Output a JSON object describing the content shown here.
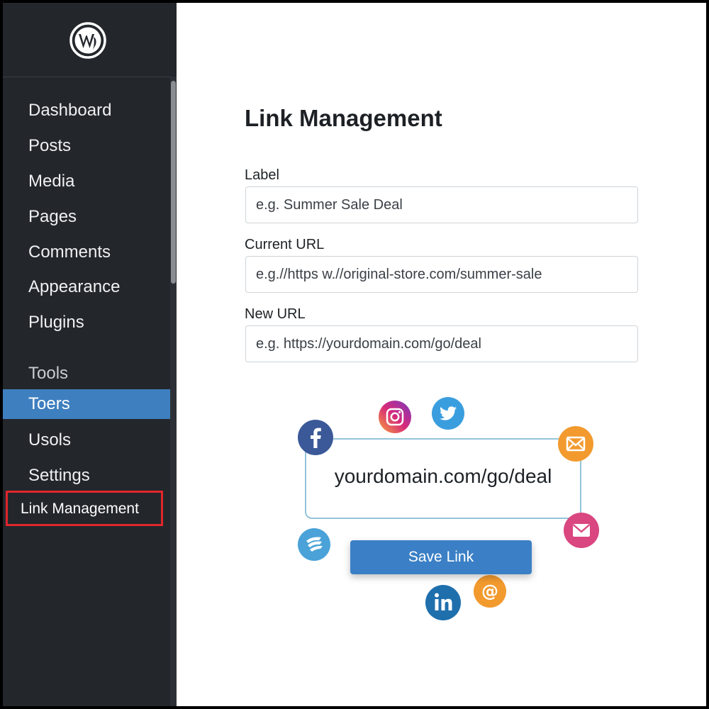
{
  "sidebar": {
    "logo_icon": "wordpress-logo-icon",
    "items": [
      {
        "label": "Dashboard"
      },
      {
        "label": "Posts"
      },
      {
        "label": "Media"
      },
      {
        "label": "Pages"
      },
      {
        "label": "Comments"
      },
      {
        "label": "Appearance"
      },
      {
        "label": "Plugins"
      },
      {
        "label": "Tools"
      },
      {
        "label": "Toers"
      },
      {
        "label": "Usols"
      },
      {
        "label": "Settings"
      },
      {
        "label": "Link Management"
      }
    ],
    "active_item": "Toers",
    "highlighted_item": "Link Management",
    "highlight_color": "#e0262b",
    "active_color": "#3e7fbf",
    "background_color": "#23262b"
  },
  "main": {
    "title": "Link Management",
    "fields": {
      "label": {
        "label": "Label",
        "placeholder": "e.g. Summer Sale Deal"
      },
      "current_url": {
        "label": "Current URL",
        "placeholder": "e.g.//https w.//original-store.com/summer-sale"
      },
      "new_url": {
        "label": "New URL",
        "placeholder": "e.g. https://yourdomain.com/go/deal"
      }
    },
    "preview": {
      "url": "yourdomain.com/go/deal",
      "save_label": "Save Link",
      "social_icons": [
        "facebook-icon",
        "instagram-icon",
        "twitter-icon",
        "mail-icon",
        "email-icon",
        "share-icon",
        "linkedin-icon",
        "at-sign-icon"
      ]
    },
    "accent_color": "#3b80c6"
  }
}
